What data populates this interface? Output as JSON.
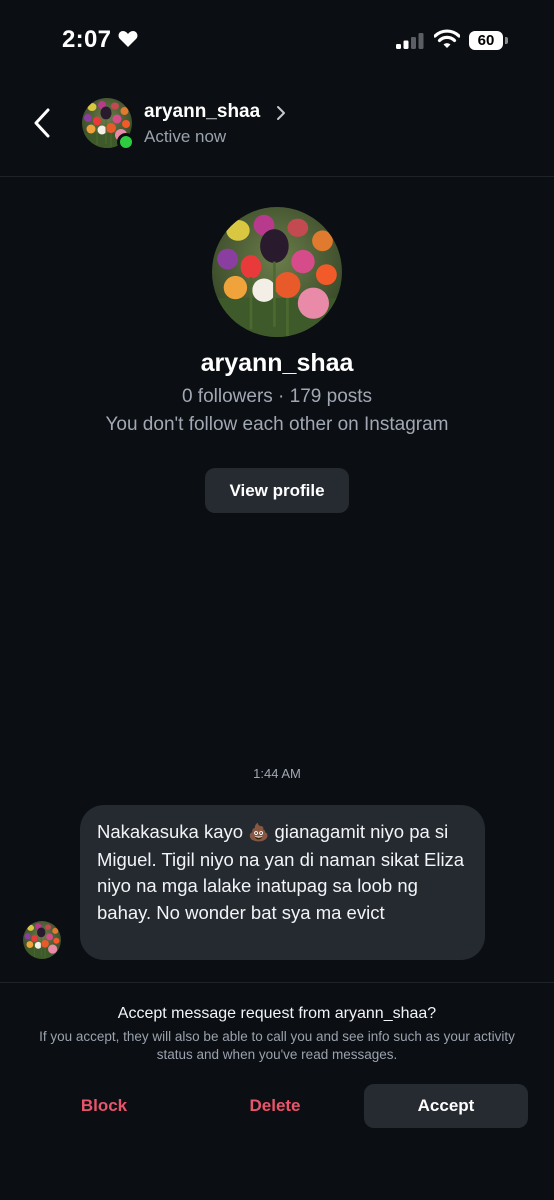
{
  "status_bar": {
    "time": "2:07",
    "battery": "60",
    "icons": [
      "heart-icon",
      "signal-icon",
      "wifi-icon",
      "battery-icon"
    ]
  },
  "header": {
    "username": "aryann_shaa",
    "status": "Active now",
    "icons": [
      "back-icon",
      "chevron-right-icon"
    ]
  },
  "profile": {
    "username": "aryann_shaa",
    "stats": "0 followers · 179 posts",
    "relation": "You don't follow each other on Instagram",
    "view_profile_label": "View profile"
  },
  "chat": {
    "timestamp": "1:44 AM",
    "message": {
      "part1": "Nakakasuka kayo ",
      "emoji": "💩",
      "part2": " gianagamit niyo pa si Miguel. Tigil niyo na yan di naman sikat Eliza niyo na mga lalake inatupag sa loob ng bahay. No wonder bat sya ma evict"
    }
  },
  "request": {
    "title": "Accept message request from aryann_shaa?",
    "description": "If you accept, they will also be able to call you and see info such as your activity status and when you've read messages.",
    "block_label": "Block",
    "delete_label": "Delete",
    "accept_label": "Accept"
  },
  "colors": {
    "background": "#0b0e13",
    "bubble": "#252a31",
    "danger": "#e8556b",
    "online": "#2ecc40"
  }
}
